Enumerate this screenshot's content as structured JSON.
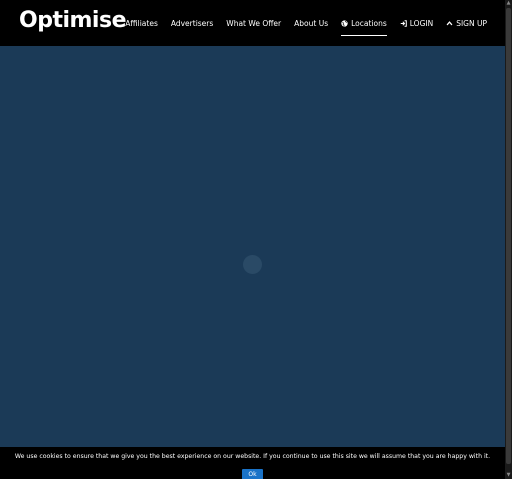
{
  "brand": {
    "logo_text": "Optimise"
  },
  "nav": {
    "items": [
      {
        "label": "Affiliates",
        "icon": ""
      },
      {
        "label": "Advertisers",
        "icon": ""
      },
      {
        "label": "What We Offer",
        "icon": ""
      },
      {
        "label": "About Us",
        "icon": ""
      },
      {
        "label": "Locations",
        "icon": "globe-icon",
        "active": true
      },
      {
        "label": "LOGIN",
        "icon": "sign-in-icon"
      },
      {
        "label": "SIGN UP",
        "icon": "chevron-up-icon"
      }
    ]
  },
  "cookie": {
    "message": "We use cookies to ensure that we give you the best experience on our website. If you continue to use this site we will assume that you are happy with it.",
    "ok_label": "Ok"
  },
  "colors": {
    "nav_bg": "#000000",
    "main_bg": "#1b3a57",
    "ok_button": "#1a73c8"
  }
}
